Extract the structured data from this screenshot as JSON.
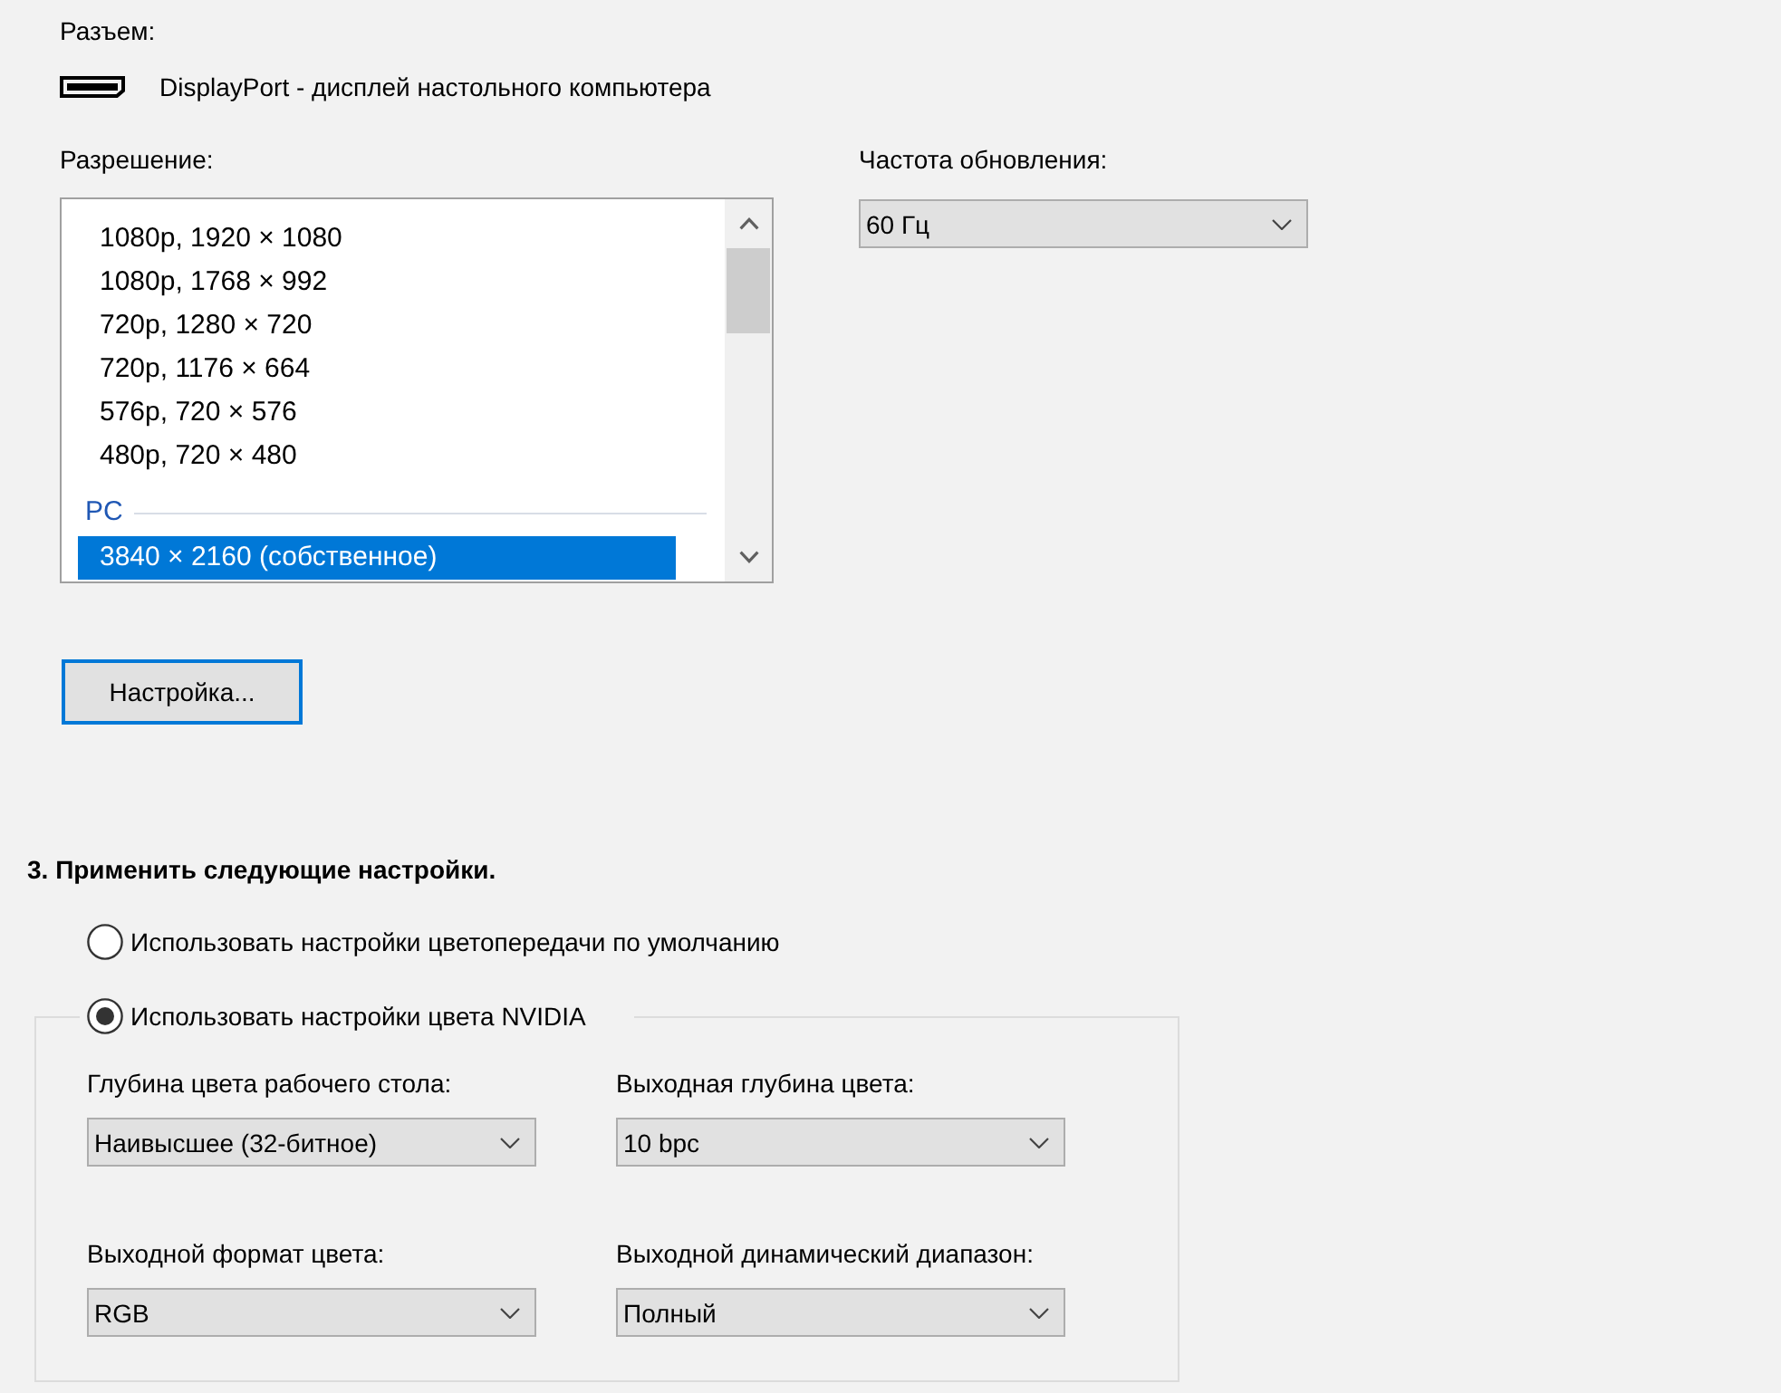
{
  "connector": {
    "label": "Разъем:",
    "value": "DisplayPort - дисплей настольного компьютера"
  },
  "resolution": {
    "label": "Разрешение:",
    "groups": [
      {
        "items": [
          {
            "text": "1080p, 1920 × 1080",
            "selected": false
          },
          {
            "text": "1080p, 1768 × 992",
            "selected": false
          },
          {
            "text": "720p, 1280 × 720",
            "selected": false
          },
          {
            "text": "720p, 1176 × 664",
            "selected": false
          },
          {
            "text": "576p, 720 × 576",
            "selected": false
          },
          {
            "text": "480p, 720 × 480",
            "selected": false
          }
        ]
      },
      {
        "header": "PC",
        "items": [
          {
            "text": "3840 × 2160 (собственное)",
            "selected": true
          }
        ]
      }
    ]
  },
  "refresh_rate": {
    "label": "Частота обновления:",
    "value": "60 Гц"
  },
  "customize_button": {
    "label": "Настройка...",
    "focused": true
  },
  "section3": {
    "title": "3. Применить следующие настройки.",
    "options": [
      {
        "label": "Использовать настройки цветопередачи по умолчанию",
        "selected": false
      },
      {
        "label": "Использовать настройки цвета NVIDIA",
        "selected": true
      }
    ],
    "fields": [
      {
        "label": "Глубина цвета рабочего стола:",
        "value": "Наивысшее (32-битное)"
      },
      {
        "label": "Выходная глубина цвета:",
        "value": "10 bpc"
      },
      {
        "label": "Выходной формат цвета:",
        "value": "RGB"
      },
      {
        "label": "Выходной динамический диапазон:",
        "value": "Полный"
      }
    ]
  }
}
